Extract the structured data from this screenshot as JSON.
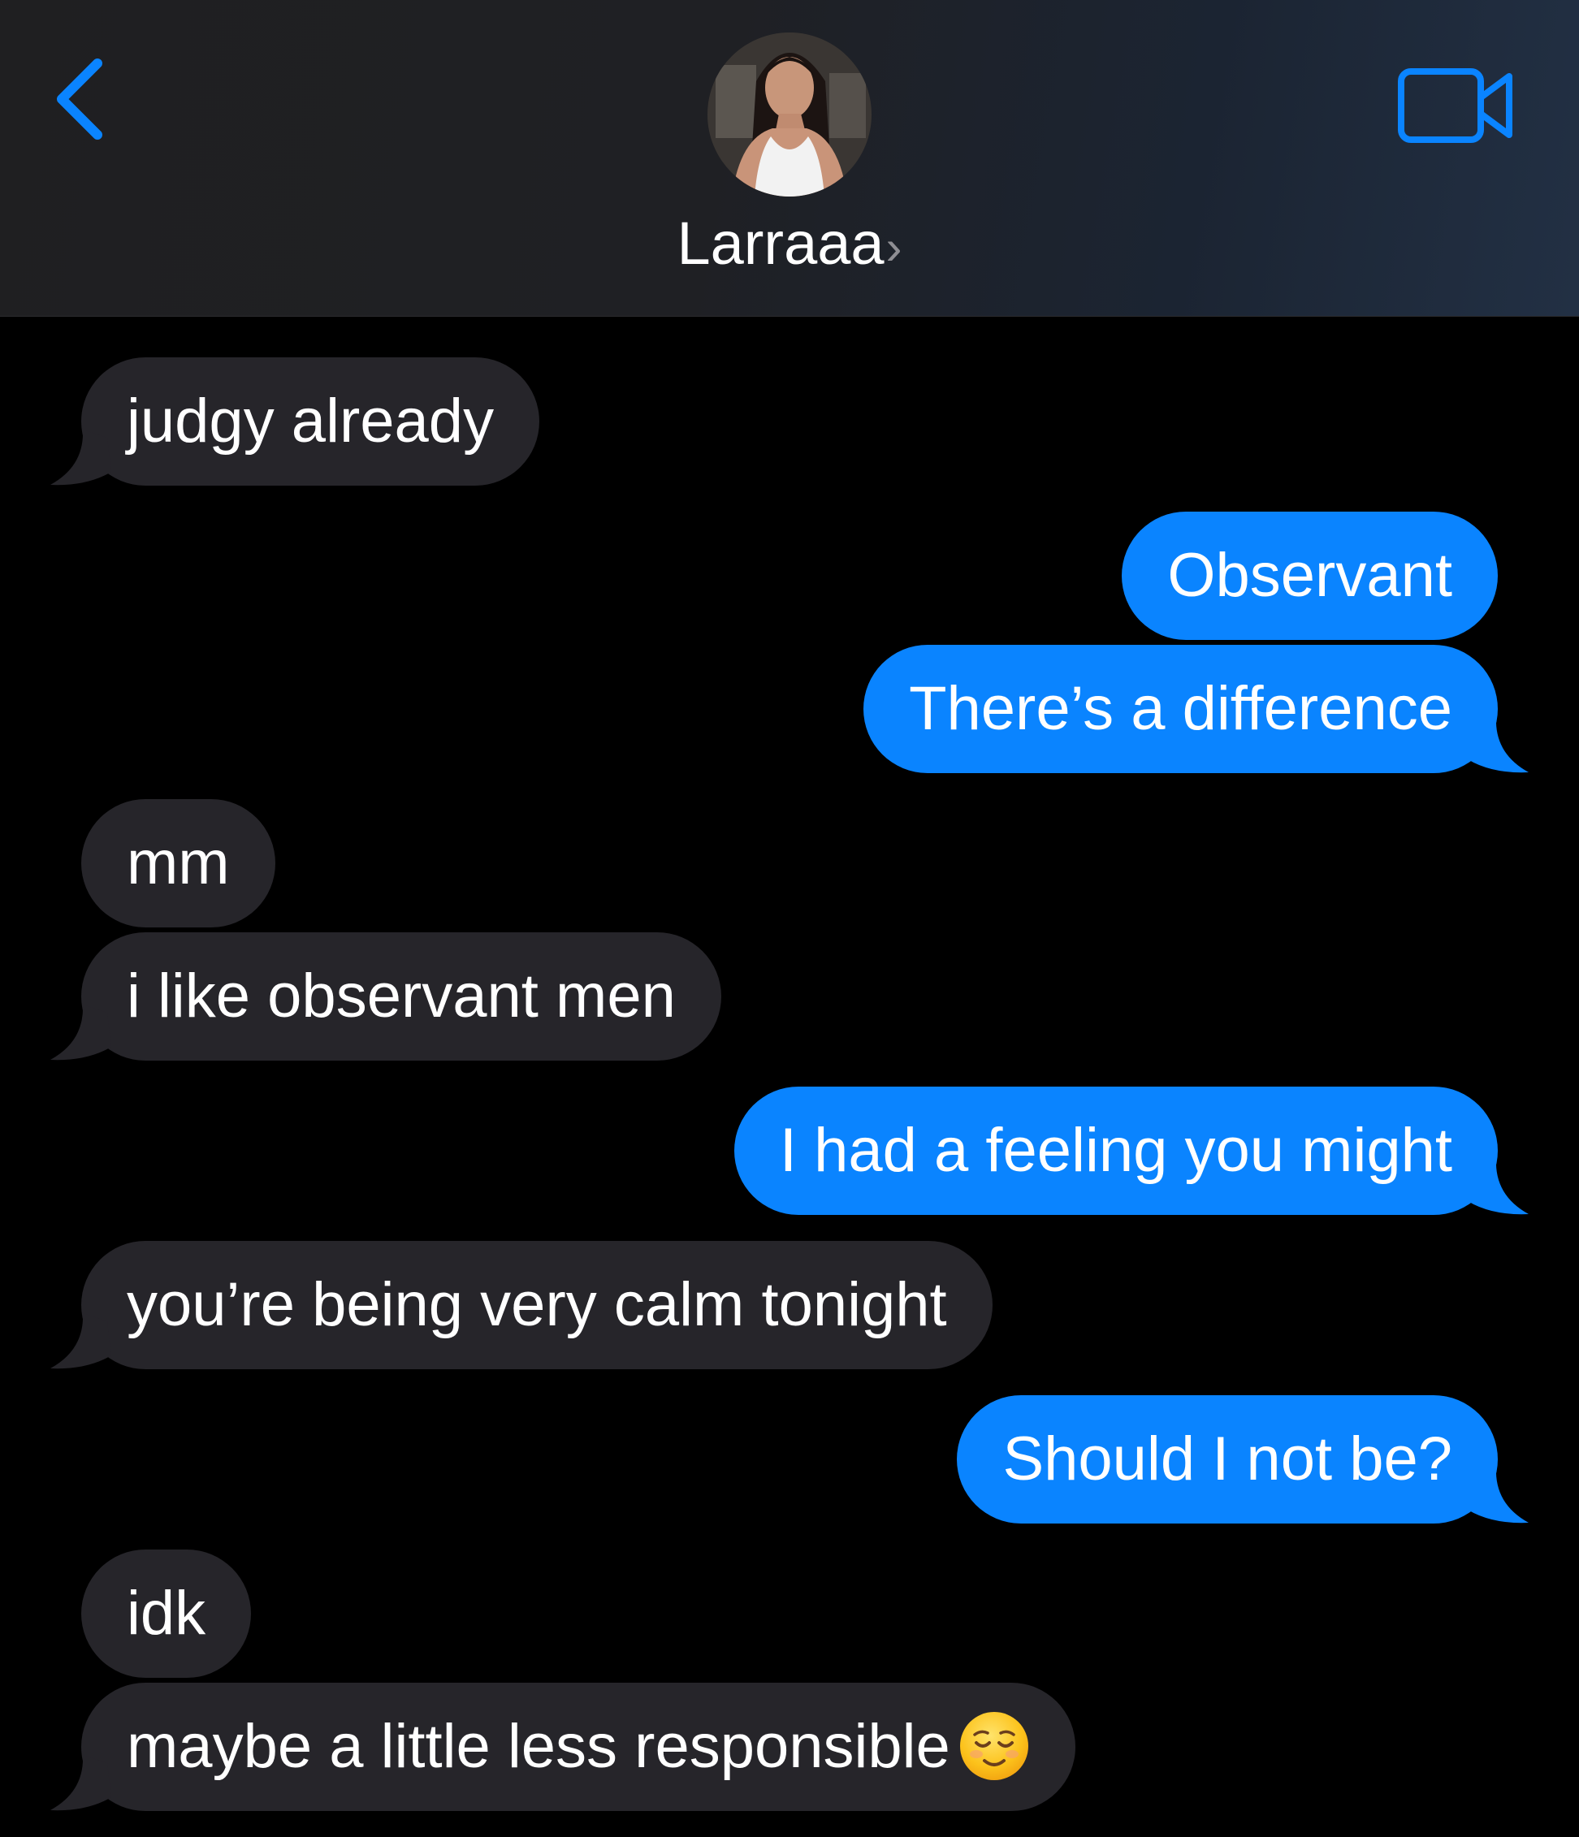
{
  "header": {
    "contact_name": "Larraaa",
    "name_chevron": "›",
    "back_icon": "chevron-left-icon",
    "video_icon": "video-camera-icon",
    "accent_color": "#0a84ff"
  },
  "messages": [
    {
      "direction": "incoming",
      "text": "judgy already"
    },
    {
      "direction": "outgoing",
      "text": "Observant"
    },
    {
      "direction": "outgoing",
      "text": "There’s a difference"
    },
    {
      "direction": "incoming",
      "text": "mm"
    },
    {
      "direction": "incoming",
      "text": "i like observant men"
    },
    {
      "direction": "outgoing",
      "text": "I had a feeling you might"
    },
    {
      "direction": "incoming",
      "text": "you’re being very calm tonight"
    },
    {
      "direction": "outgoing",
      "text": "Should I not be?"
    },
    {
      "direction": "incoming",
      "text": "idk"
    },
    {
      "direction": "incoming",
      "text": "maybe a little less responsible",
      "emoji": "relieved-face-emoji"
    }
  ],
  "colors": {
    "incoming_bubble": "#26252a",
    "outgoing_bubble": "#0a84ff",
    "background": "#000000"
  }
}
